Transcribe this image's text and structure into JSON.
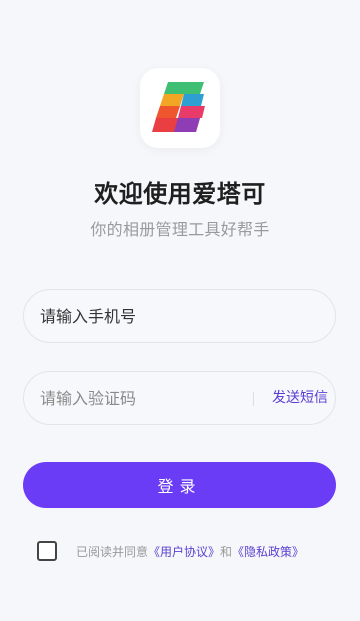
{
  "app": {
    "logo_icon": "app-logo-icon",
    "title": "欢迎使用爱塔可",
    "subtitle": "你的相册管理工具好帮手"
  },
  "form": {
    "phone_placeholder": "请输入手机号",
    "code_placeholder": "请输入验证码",
    "send_sms_label": "发送短信",
    "login_label": "登录"
  },
  "agreement": {
    "prefix": "已阅读并同意",
    "user_agreement": "《用户协议》",
    "conjunction": "和",
    "privacy_policy": "《隐私政策》",
    "checked": false
  },
  "colors": {
    "accent": "#6a3cf5",
    "link": "#5b3fd0",
    "background": "#f6f7fb"
  }
}
